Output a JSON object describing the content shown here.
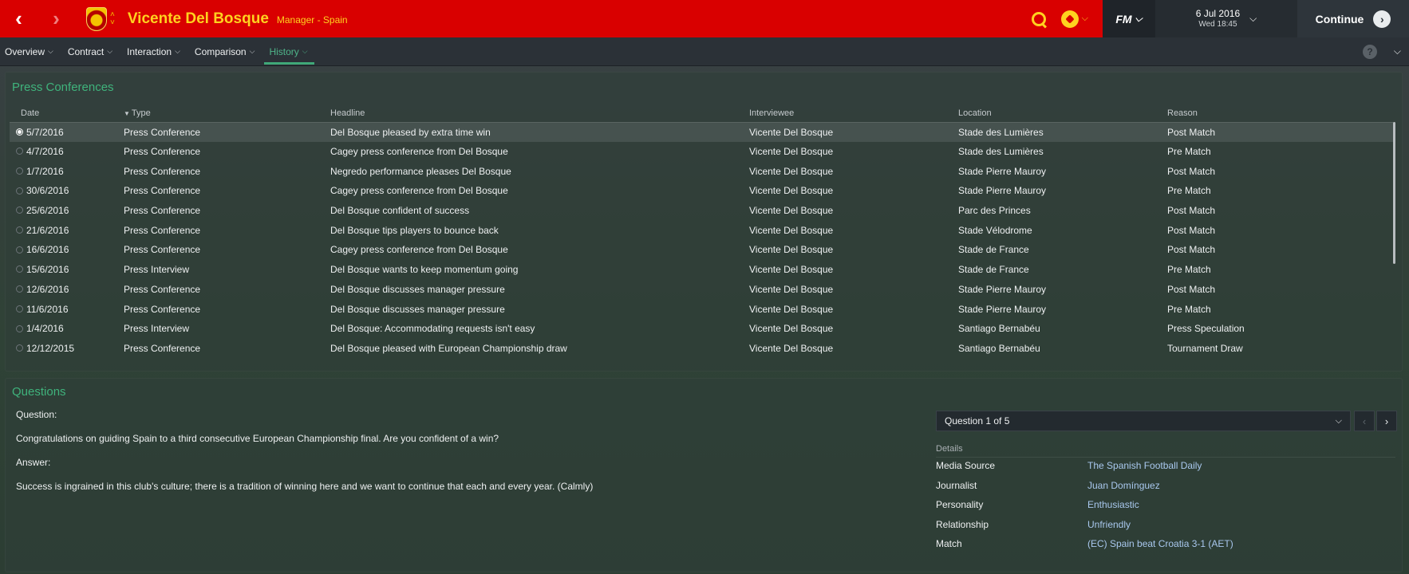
{
  "header": {
    "manager_name": "Vicente Del Bosque",
    "manager_role": "Manager - Spain",
    "date_main": "6 Jul 2016",
    "date_sub": "Wed 18:45",
    "fm_label": "FM",
    "continue_label": "Continue",
    "back_icon": "back-arrow-icon",
    "forward_icon": "forward-arrow-icon"
  },
  "tabs": [
    {
      "label": "Overview"
    },
    {
      "label": "Contract"
    },
    {
      "label": "Interaction"
    },
    {
      "label": "Comparison"
    },
    {
      "label": "History"
    }
  ],
  "press": {
    "title": "Press Conferences",
    "columns": [
      "Date",
      "Type",
      "Headline",
      "Interviewee",
      "Location",
      "Reason"
    ],
    "rows": [
      {
        "date": "5/7/2016",
        "type": "Press Conference",
        "headline": "Del Bosque pleased by extra time win",
        "interviewee": "Vicente Del Bosque",
        "location": "Stade des Lumières",
        "reason": "Post Match"
      },
      {
        "date": "4/7/2016",
        "type": "Press Conference",
        "headline": "Cagey press conference from Del Bosque",
        "interviewee": "Vicente Del Bosque",
        "location": "Stade des Lumières",
        "reason": "Pre Match"
      },
      {
        "date": "1/7/2016",
        "type": "Press Conference",
        "headline": "Negredo performance pleases Del Bosque",
        "interviewee": "Vicente Del Bosque",
        "location": "Stade Pierre Mauroy",
        "reason": "Post Match"
      },
      {
        "date": "30/6/2016",
        "type": "Press Conference",
        "headline": "Cagey press conference from Del Bosque",
        "interviewee": "Vicente Del Bosque",
        "location": "Stade Pierre Mauroy",
        "reason": "Pre Match"
      },
      {
        "date": "25/6/2016",
        "type": "Press Conference",
        "headline": "Del Bosque confident of success",
        "interviewee": "Vicente Del Bosque",
        "location": "Parc des Princes",
        "reason": "Post Match"
      },
      {
        "date": "21/6/2016",
        "type": "Press Conference",
        "headline": "Del Bosque tips players to bounce back",
        "interviewee": "Vicente Del Bosque",
        "location": "Stade Vélodrome",
        "reason": "Post Match"
      },
      {
        "date": "16/6/2016",
        "type": "Press Conference",
        "headline": "Cagey press conference from Del Bosque",
        "interviewee": "Vicente Del Bosque",
        "location": "Stade de France",
        "reason": "Post Match"
      },
      {
        "date": "15/6/2016",
        "type": "Press Interview",
        "headline": "Del Bosque wants to keep momentum going",
        "interviewee": "Vicente Del Bosque",
        "location": "Stade de France",
        "reason": "Pre Match"
      },
      {
        "date": "12/6/2016",
        "type": "Press Conference",
        "headline": "Del Bosque discusses manager pressure",
        "interviewee": "Vicente Del Bosque",
        "location": "Stade Pierre Mauroy",
        "reason": "Post Match"
      },
      {
        "date": "11/6/2016",
        "type": "Press Conference",
        "headline": "Del Bosque discusses manager pressure",
        "interviewee": "Vicente Del Bosque",
        "location": "Stade Pierre Mauroy",
        "reason": "Pre Match"
      },
      {
        "date": "1/4/2016",
        "type": "Press Interview",
        "headline": "Del Bosque: Accommodating requests isn't easy",
        "interviewee": "Vicente Del Bosque",
        "location": "Santiago Bernabéu",
        "reason": "Press Speculation"
      },
      {
        "date": "12/12/2015",
        "type": "Press Conference",
        "headline": "Del Bosque pleased with European Championship draw",
        "interviewee": "Vicente Del Bosque",
        "location": "Santiago Bernabéu",
        "reason": "Tournament Draw"
      }
    ]
  },
  "questions": {
    "title": "Questions",
    "question_label": "Question:",
    "question_text": "Congratulations on guiding Spain to a third consecutive European Championship final. Are you confident of a win?",
    "answer_label": "Answer:",
    "answer_text": "Success is ingrained in this club's culture; there is a tradition of winning here and we want to continue that each and every year. (Calmly)",
    "selector_value": "Question 1 of 5",
    "details_title": "Details",
    "details": [
      {
        "label": "Media Source",
        "value": "The Spanish Football Daily"
      },
      {
        "label": "Journalist",
        "value": "Juan Domínguez"
      },
      {
        "label": "Personality",
        "value": "Enthusiastic"
      },
      {
        "label": "Relationship",
        "value": "Unfriendly"
      },
      {
        "label": "Match",
        "value": "(EC) Spain beat Croatia 3-1 (AET)"
      }
    ]
  },
  "colors": {
    "header_red": "#d90000",
    "title_yellow": "#ffd21f",
    "accent_green": "#3fb37c",
    "link_blue": "#a9c8ee"
  }
}
